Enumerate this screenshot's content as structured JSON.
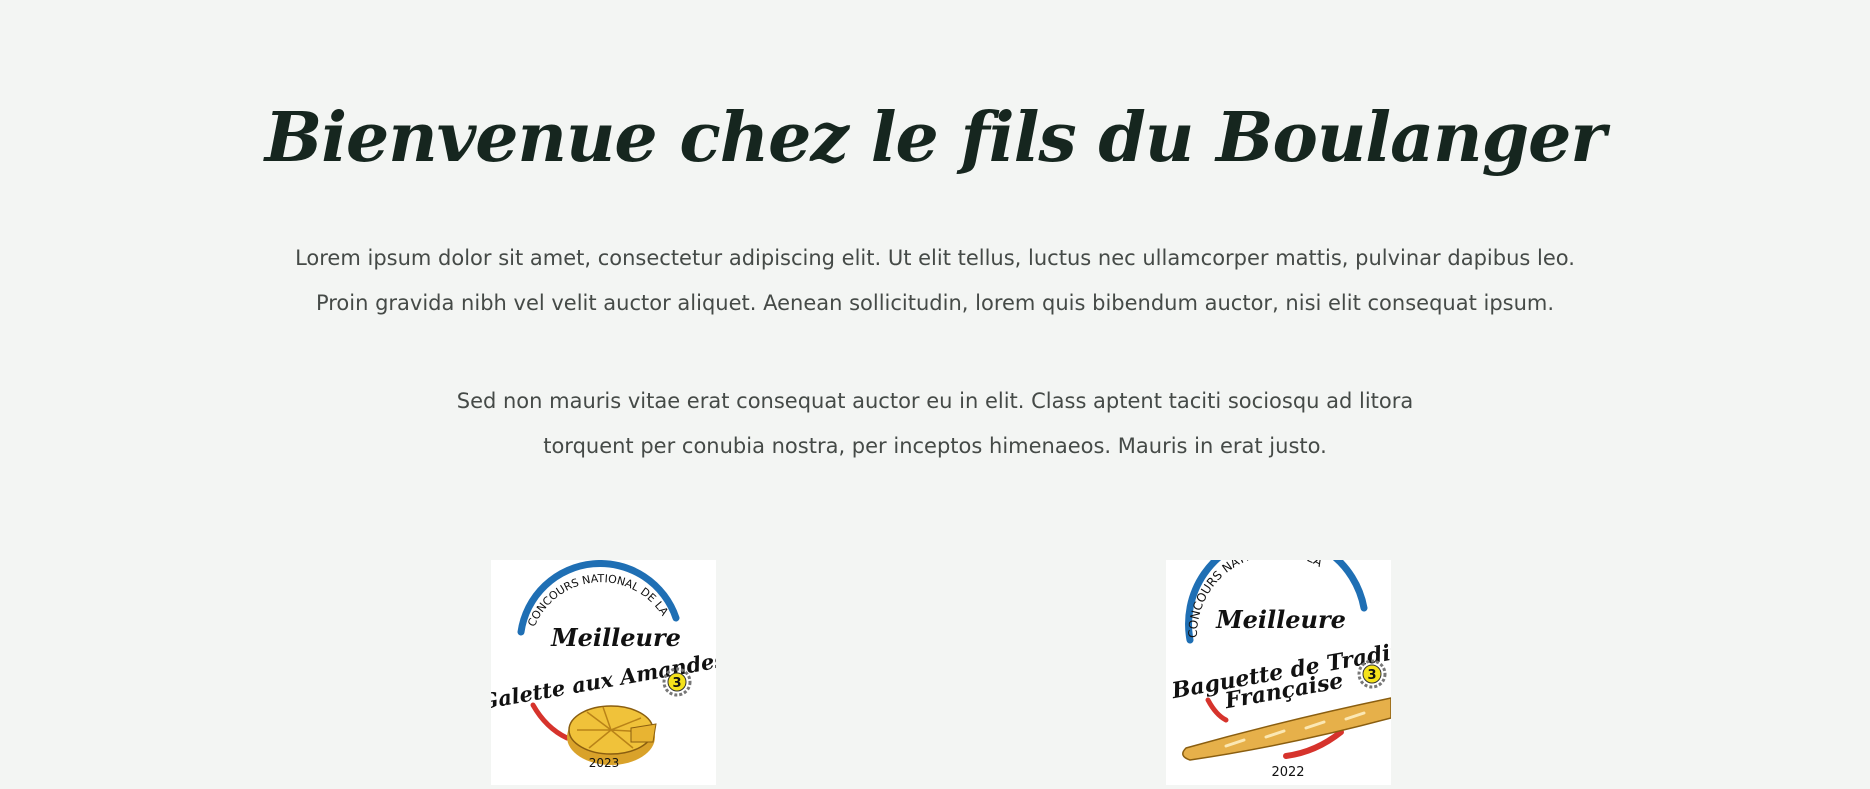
{
  "header": {
    "title": "Bienvenue chez le fils du Boulanger"
  },
  "intro": {
    "paragraph1_lines": [
      "Lorem ipsum dolor sit amet, consectetur adipiscing elit. Ut elit tellus, luctus nec ullamcorper mattis, pulvinar dapibus leo.",
      "Proin gravida nibh vel velit auctor aliquet. Aenean sollicitudin, lorem quis bibendum auctor, nisi elit consequat ipsum."
    ],
    "paragraph2_lines": [
      "Sed non mauris vitae erat consequat auctor eu in elit. Class aptent taciti sociosqu ad litora",
      "torquent per conubia nostra, per inceptos himenaeos. Mauris in erat justo."
    ]
  },
  "awards": [
    {
      "arc_text": "CONCOURS NATIONAL DE LA",
      "line1": "Meilleure",
      "line2": "Galette aux Amandes",
      "rank": "3",
      "year": "2023",
      "icon": "galette-icon"
    },
    {
      "arc_text": "CONCOURS NATIONAL DE LA",
      "line1": "Meilleure",
      "line2": "Baguette de Tradition",
      "line3": "Française",
      "rank": "3",
      "year": "2022",
      "icon": "baguette-icon"
    }
  ],
  "colors": {
    "background": "#f3f5f3",
    "title": "#16261f",
    "body_text": "#454a47",
    "badge_blue": "#1f6fb4",
    "badge_red": "#d6332c",
    "pastry_gold": "#f0c23a"
  }
}
